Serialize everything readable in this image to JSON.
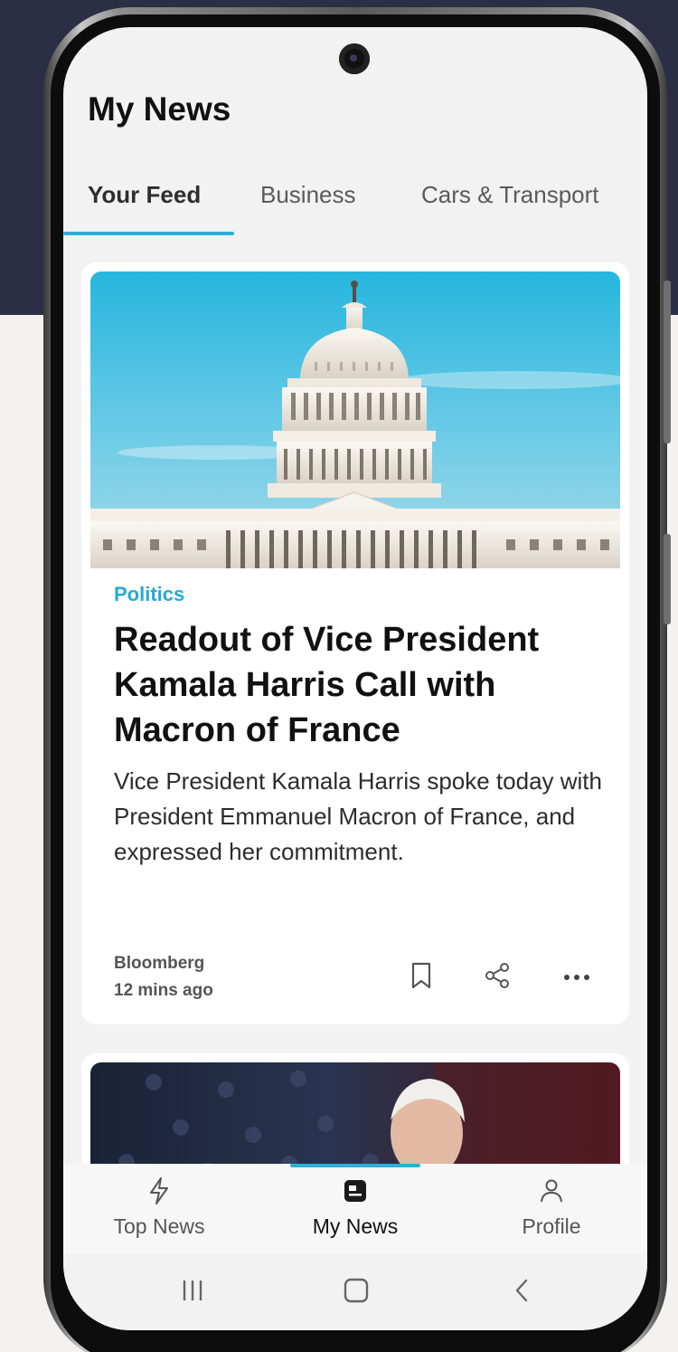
{
  "app": {
    "title": "My News"
  },
  "tabs": [
    {
      "label": "Your Feed",
      "active": true
    },
    {
      "label": "Business",
      "active": false
    },
    {
      "label": "Cars & Transport",
      "active": false
    }
  ],
  "articles": [
    {
      "image_icon": "capitol-building-photo",
      "category": "Politics",
      "headline": "Readout of Vice President Kamala Harris Call with Macron of France",
      "summary": "Vice President Kamala Harris spoke today with President Emmanuel Macron of France, and expressed her commitment.",
      "source": "Bloomberg",
      "time": "12 mins ago",
      "actions": [
        "bookmark-icon",
        "share-icon",
        "more-icon"
      ]
    },
    {
      "image_icon": "person-with-flag-photo"
    }
  ],
  "bottom_nav": [
    {
      "label": "Top News",
      "icon": "lightning-icon",
      "active": false
    },
    {
      "label": "My News",
      "icon": "news-icon",
      "active": true
    },
    {
      "label": "Profile",
      "icon": "person-icon",
      "active": false
    }
  ],
  "system_nav": [
    "recents-icon",
    "home-icon",
    "back-icon"
  ],
  "colors": {
    "accent": "#2bb0d8",
    "background_top": "#2b2e45",
    "background": "#f3f2f0"
  }
}
